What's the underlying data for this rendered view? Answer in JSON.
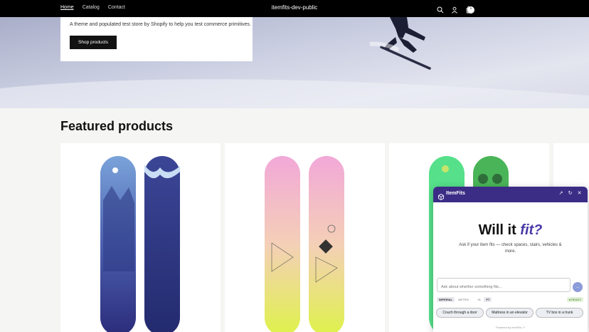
{
  "header": {
    "nav": [
      "Home",
      "Catalog",
      "Contact"
    ],
    "store_title": "itemfits-dev-public",
    "cart_count": "0",
    "icons": [
      "search-icon",
      "account-icon",
      "cart-icon"
    ]
  },
  "hero": {
    "text": "A theme and populated test store by Shopify to help you test commerce primitives.",
    "button": "Shop products"
  },
  "featured": {
    "title": "Featured products"
  },
  "widget": {
    "brand": "ItemFits",
    "title_plain": "Will it ",
    "title_accent": "fit?",
    "subtitle": "Ask if your item fits — check spaces, stairs, vehicles & more.",
    "placeholder": "Ask about whether something fits...",
    "units": [
      "IMPERIAL",
      "METRIC",
      "IN",
      "FT"
    ],
    "status": "● READY",
    "chips": [
      "Couch through a door",
      "Mattress in an elevator",
      "TV box in a trunk"
    ],
    "powered": "Powered by ItemFits ↗",
    "accent_color": "#3b2d86"
  }
}
